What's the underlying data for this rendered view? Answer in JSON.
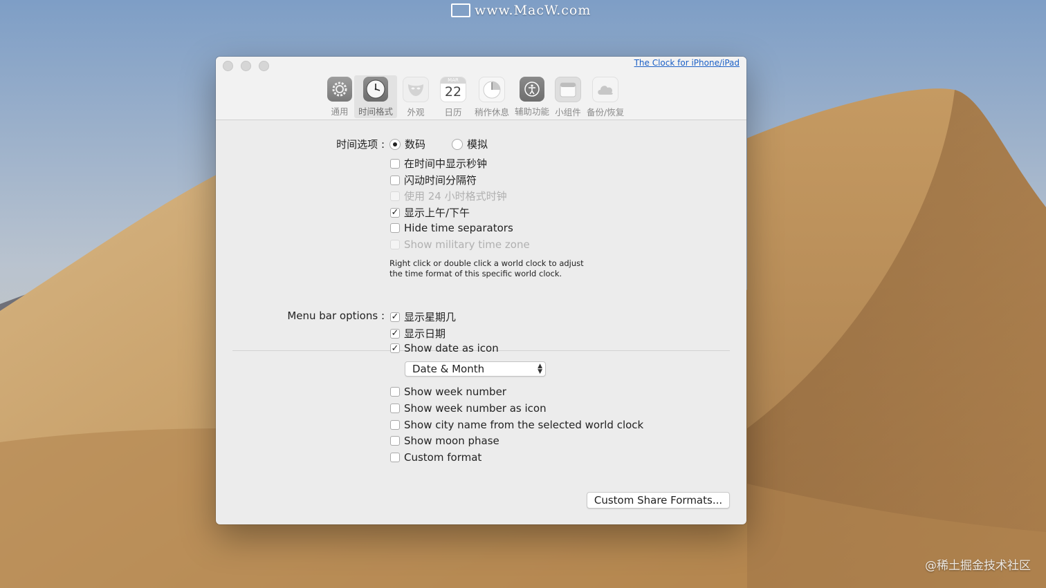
{
  "watermarks": {
    "top": "www.MacW.com",
    "bottom": "@稀土掘金技术社区"
  },
  "window": {
    "top_link": "The Clock for iPhone/iPad",
    "tabs": [
      {
        "label": "通用",
        "icon": "gear-icon"
      },
      {
        "label": "时间格式",
        "icon": "clock-icon",
        "active": true
      },
      {
        "label": "外观",
        "icon": "mask-icon"
      },
      {
        "label": "日历",
        "icon": "calendar-icon",
        "month": "MAR",
        "day": "22"
      },
      {
        "label": "稍作休息",
        "icon": "pie-timer-icon"
      },
      {
        "label": "辅助功能",
        "icon": "accessibility-icon"
      },
      {
        "label": "小组件",
        "icon": "widget-icon"
      },
      {
        "label": "备份/恢复",
        "icon": "cloud-icon"
      }
    ]
  },
  "time_options": {
    "label": "时间选项 :",
    "radio_digital": "数码",
    "radio_analog": "模拟",
    "selected": "digital",
    "checkboxes": [
      {
        "label": "在时间中显示秒钟",
        "checked": false,
        "disabled": false
      },
      {
        "label": "闪动时间分隔符",
        "checked": false,
        "disabled": false
      },
      {
        "label": "使用 24 小时格式时钟",
        "checked": false,
        "disabled": true
      },
      {
        "label": "显示上午/下午",
        "checked": true,
        "disabled": false
      },
      {
        "label": "Hide time separators",
        "checked": false,
        "disabled": false
      },
      {
        "label": "Show military time zone",
        "checked": false,
        "disabled": true
      }
    ],
    "note_line1": "Right click or double click a world clock to adjust",
    "note_line2": "the time format of this specific world clock."
  },
  "menu_bar_options": {
    "label": "Menu bar options :",
    "checkboxes_top": [
      {
        "label": "显示星期几",
        "checked": true
      },
      {
        "label": "显示日期",
        "checked": true
      },
      {
        "label": "Show date as icon",
        "checked": true
      }
    ],
    "date_icon_select": "Date & Month",
    "checkboxes_bottom": [
      {
        "label": "Show week number",
        "checked": false
      },
      {
        "label": "Show week number as icon",
        "checked": false
      },
      {
        "label": "Show city name from the selected world clock",
        "checked": false
      },
      {
        "label": "Show moon phase",
        "checked": false
      },
      {
        "label": "Custom format",
        "checked": false
      }
    ]
  },
  "buttons": {
    "custom_share": "Custom Share Formats..."
  }
}
